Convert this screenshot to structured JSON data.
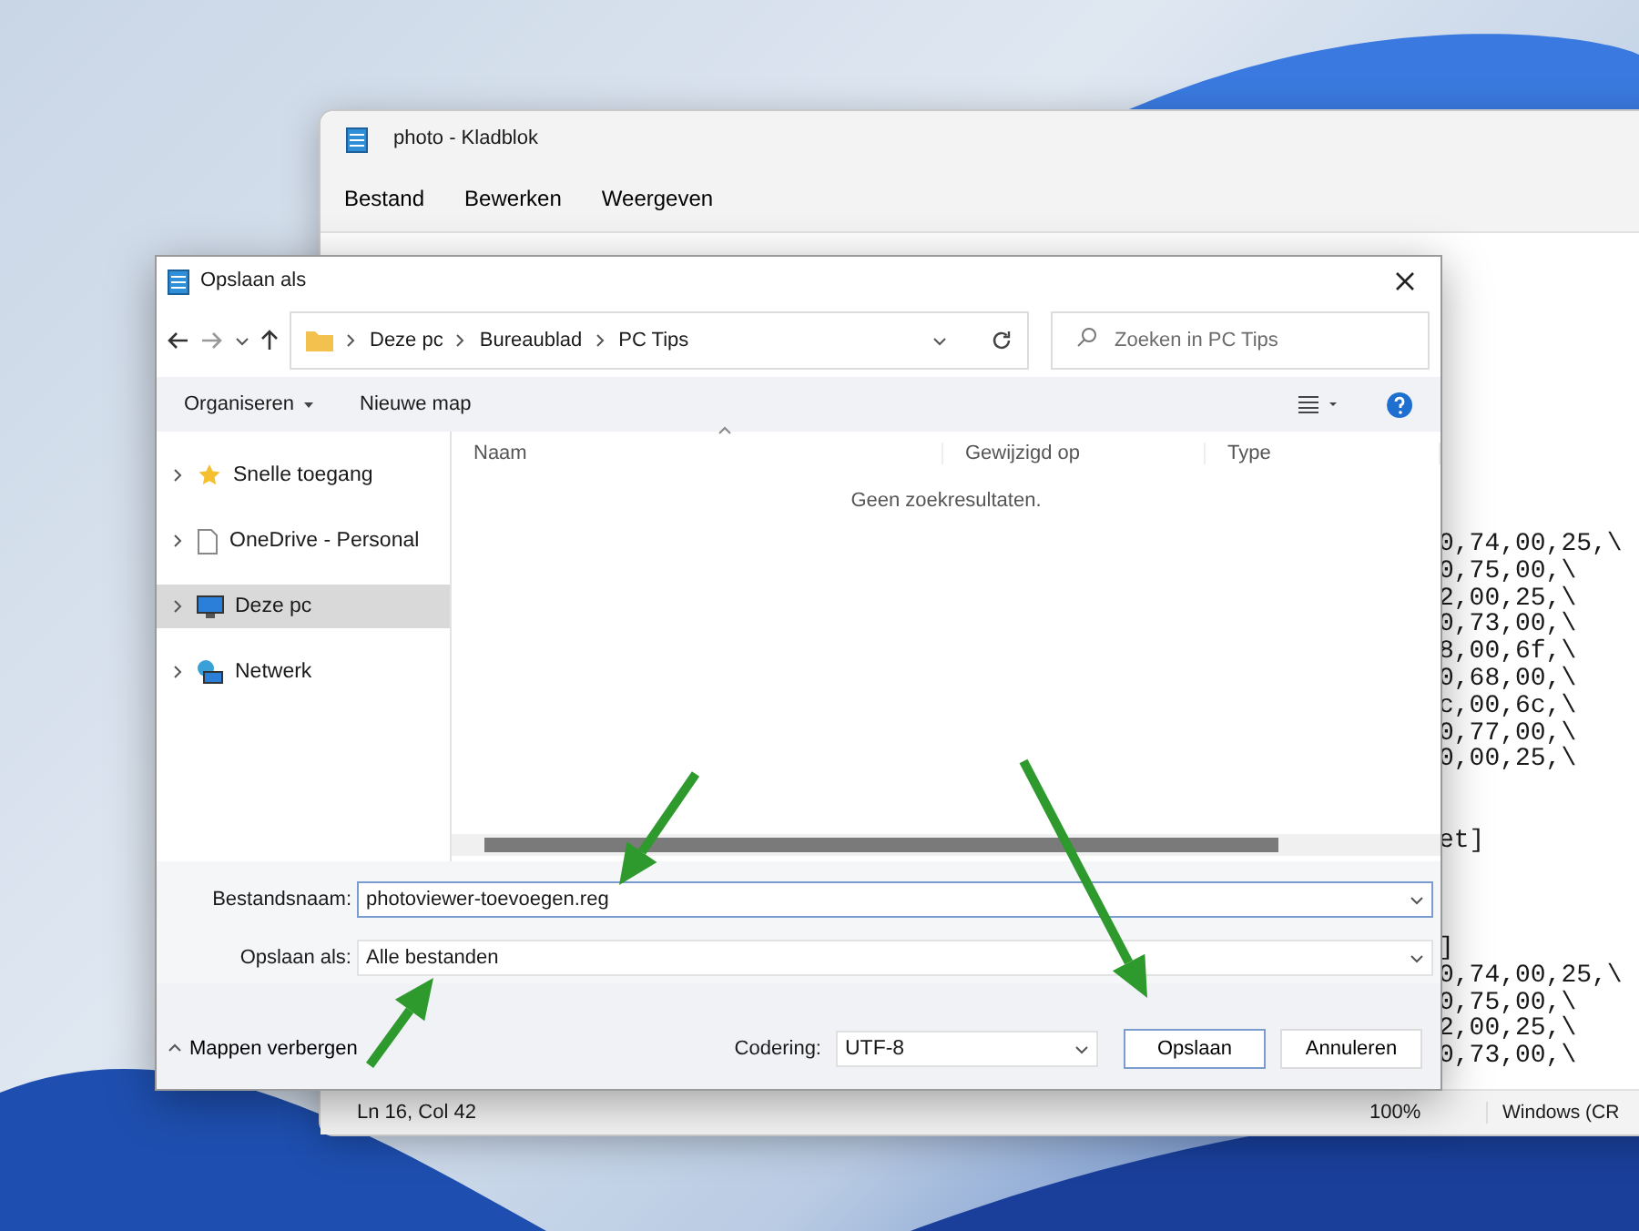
{
  "notepad": {
    "title": "photo - Kladblok",
    "menu": [
      "Bestand",
      "Bewerken",
      "Weergeven"
    ],
    "blocks": [
      [
        "0,74,00,25,\\",
        "0,75,00,\\",
        "2,00,25,\\",
        "0,73,00,\\",
        "8,00,6f,\\",
        "0,68,00,\\",
        "c,00,6c,\\",
        "0,77,00,\\",
        "0,00,25,\\"
      ],
      [
        "et]"
      ],
      [
        "]",
        "0,74,00,25,\\",
        "0,75,00,\\",
        "2,00,25,\\",
        "0,73,00,\\"
      ]
    ],
    "status": [
      "Ln 16, Col 42",
      "100%",
      "Windows (CR"
    ]
  },
  "dialog": {
    "title": "Opslaan als",
    "path": [
      "Deze pc",
      "Bureaublad",
      "PC Tips"
    ],
    "search": {
      "placeholder": "Zoeken in PC Tips"
    },
    "toolbar": [
      "Organiseren",
      "Nieuwe map"
    ],
    "sidebar": [
      {
        "label": "Snelle toegang",
        "kind": "star",
        "selected": false
      },
      {
        "label": "OneDrive - Personal",
        "kind": "file",
        "selected": false
      },
      {
        "label": "Deze pc",
        "kind": "pc",
        "selected": true
      },
      {
        "label": "Netwerk",
        "kind": "network",
        "selected": false
      }
    ],
    "columns": [
      "Naam",
      "Gewijzigd op",
      "Type"
    ],
    "empty_message": "Geen zoekresultaten.",
    "filename": {
      "label": "Bestandsnaam:",
      "value": "photoviewer-toevoegen.reg"
    },
    "filetype": {
      "label": "Opslaan als:",
      "value": "Alle bestanden"
    },
    "hide_folders": "Mappen verbergen",
    "encoding": {
      "label": "Codering:",
      "value": "UTF-8"
    },
    "buttons": [
      {
        "label": "Opslaan",
        "kind": "primary"
      },
      {
        "label": "Annuleren",
        "kind": "secondary"
      }
    ]
  }
}
